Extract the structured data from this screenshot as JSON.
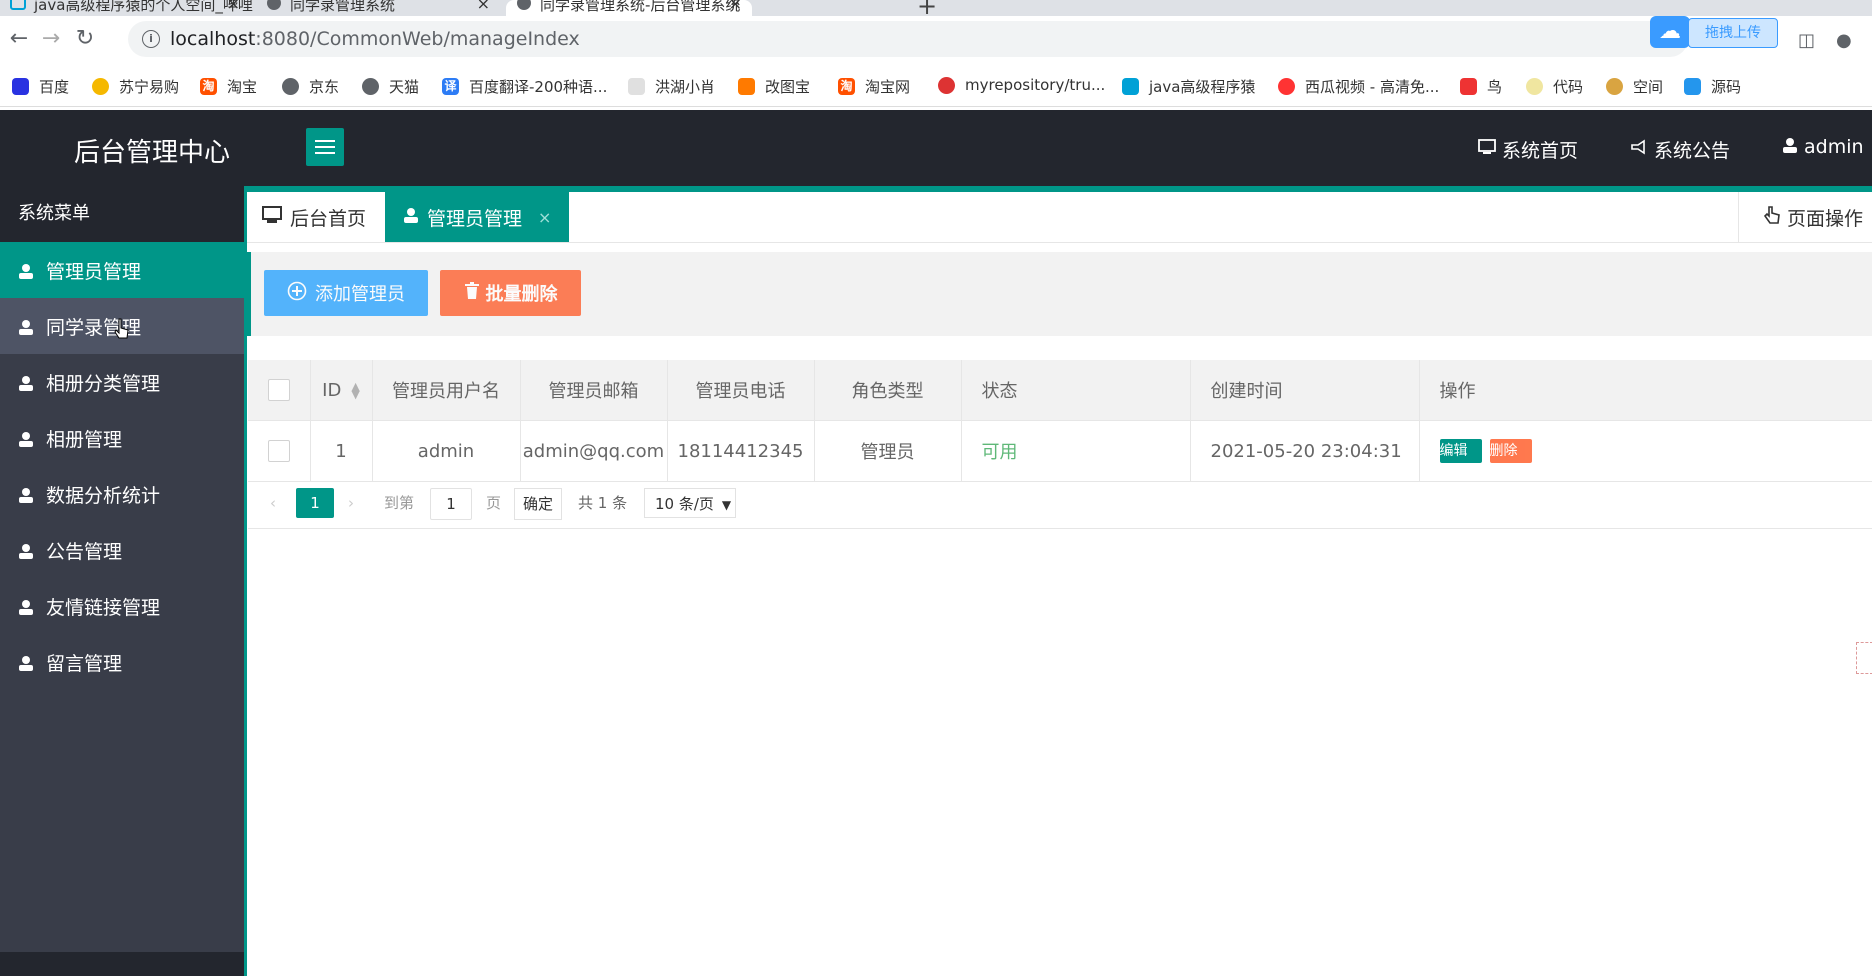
{
  "browser": {
    "tabs": [
      {
        "title": "java高级程序猿的个人空间_哔哩",
        "close": "×"
      },
      {
        "title": "同学录管理系统",
        "close": "×"
      },
      {
        "title": "同学录管理系统-后台管理系统",
        "close": "×"
      }
    ],
    "new_tab": "+",
    "url_host": "localhost",
    "url_path": ":8080/CommonWeb/manageIndex",
    "upload_label": "拖拽上传",
    "bookmarks": [
      "百度",
      "苏宁易购",
      "淘宝",
      "京东",
      "天猫",
      "百度翻译-200种语...",
      "洪湖小肖",
      "改图宝",
      "淘宝网",
      "myrepository/tru...",
      "java高级程序猿",
      "西瓜视频 - 高清免...",
      "鸟",
      "代码",
      "空间",
      "源码"
    ],
    "bookmark_icon_text": {
      "taobao": "淘",
      "translate": "译"
    }
  },
  "header": {
    "logo": "后台管理中心",
    "nav": {
      "home": "系统首页",
      "notice": "系统公告",
      "user": "admin"
    }
  },
  "sidebar": {
    "title": "系统菜单",
    "items": [
      {
        "label": "管理员管理"
      },
      {
        "label": "同学录管理"
      },
      {
        "label": "相册分类管理"
      },
      {
        "label": "相册管理"
      },
      {
        "label": "数据分析统计"
      },
      {
        "label": "公告管理"
      },
      {
        "label": "友情链接管理"
      },
      {
        "label": "留言管理"
      }
    ]
  },
  "page_tabs": {
    "home": "后台首页",
    "current": "管理员管理",
    "close": "×",
    "ops": "页面操作"
  },
  "actions": {
    "add": "添加管理员",
    "batch_delete": "批量删除"
  },
  "table": {
    "headers": [
      "ID",
      "管理员用户名",
      "管理员邮箱",
      "管理员电话",
      "角色类型",
      "状态",
      "创建时间",
      "操作"
    ],
    "rows": [
      {
        "id": "1",
        "username": "admin",
        "email": "admin@qq.com",
        "phone": "18114412345",
        "role": "管理员",
        "status": "可用",
        "created": "2021-05-20 23:04:31",
        "edit": "编辑",
        "delete": "删除"
      }
    ]
  },
  "pager": {
    "current": "1",
    "goto": "到第",
    "page_value": "1",
    "page_unit": "页",
    "confirm": "确定",
    "total": "共 1 条",
    "per_page": "10 条/页"
  },
  "colors": {
    "accent": "#009688",
    "header_bg": "#23262e",
    "sidebar_bg": "#393d49",
    "add_btn": "#1e9fff",
    "del_btn": "#ff5722",
    "status_ok": "#5fb878"
  }
}
